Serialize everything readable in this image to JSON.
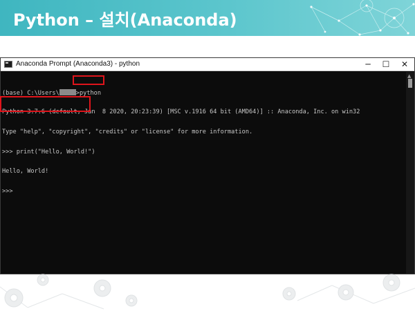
{
  "slide": {
    "title": "Python – 설치(Anaconda)"
  },
  "window": {
    "title": "Anaconda Prompt (Anaconda3) - python",
    "controls": {
      "minimize": "─",
      "maximize": "☐",
      "close": "✕"
    }
  },
  "console": {
    "prompt_prefix": "(base) C:\\Users\\",
    "command": ">python",
    "version_line": "Python 3.7.6 (default, Jan  8 2020, 20:23:39) [MSC v.1916 64 bit (AMD64)] :: Anaconda, Inc. on win32",
    "help_line": "Type \"help\", \"copyright\", \"credits\" or \"license\" for more information.",
    "print_command": ">>> print(\"Hello, World!\")",
    "output": "Hello, World!",
    "final_prompt": ">>>"
  },
  "colors": {
    "header_teal": "#3fb6c0",
    "console_bg": "#0c0c0c",
    "console_text": "#c8c8c8",
    "highlight_red": "#e0141b"
  }
}
